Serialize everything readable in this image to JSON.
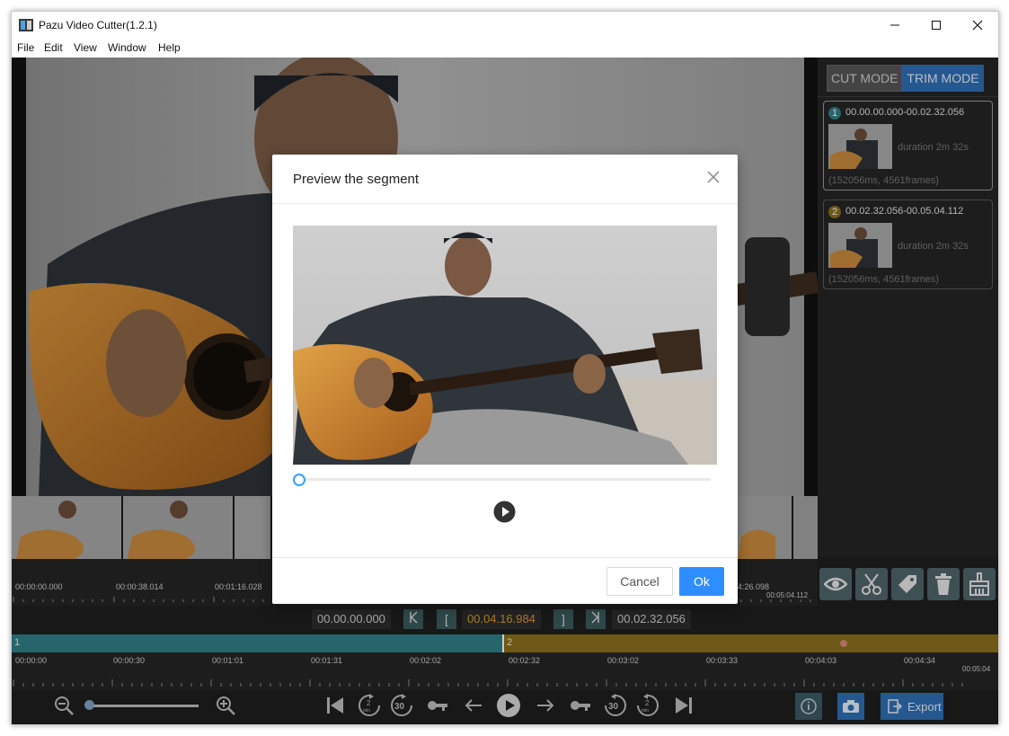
{
  "window": {
    "title": "Pazu Video Cutter(1.2.1)"
  },
  "menu": [
    "File",
    "Edit",
    "View",
    "Window",
    "Help"
  ],
  "modes": {
    "cut": "CUT MODE",
    "trim": "TRIM MODE"
  },
  "segments": [
    {
      "num": "1",
      "range": "00.00.00.000-00.02.32.056",
      "duration": "duration 2m 32s",
      "info": "(152056ms, 4561frames)",
      "color": "#2f7f86"
    },
    {
      "num": "2",
      "range": "00.02.32.056-00.05.04.112",
      "duration": "duration 2m 32s",
      "info": "(152056ms, 4561frames)",
      "color": "#8a6f1d"
    }
  ],
  "strip_ruler": {
    "labels": [
      "00:00:00.000",
      "00:00:38.014",
      "00:01:16.028",
      "4:26.098",
      "00:05:04.112"
    ]
  },
  "nav": {
    "start": "00.00.00.000",
    "current": "00.04.16.984",
    "length": "00.02.32.056",
    "btn_first": "K",
    "btn_mark_in": "[",
    "btn_mark_out": "]",
    "btn_last": ">|"
  },
  "track": {
    "seg1_label": "1",
    "seg2_label": "2"
  },
  "timeline_ruler": {
    "labels": [
      "00:00:00",
      "00:00:30",
      "00:01:01",
      "00:01:31",
      "00:02:02",
      "00:02:32",
      "00:03:02",
      "00:03:33",
      "00:04:03",
      "00:04:34",
      "00:05:04"
    ]
  },
  "controls": {
    "export": "Export"
  },
  "dialog": {
    "title": "Preview the segment",
    "cancel": "Cancel",
    "ok": "Ok",
    "progress": 0
  },
  "colors": {
    "accent": "#2f8eff",
    "segment1": "#2f7f86",
    "segment2": "#8a6f1d",
    "time_current": "#d79a2a"
  }
}
